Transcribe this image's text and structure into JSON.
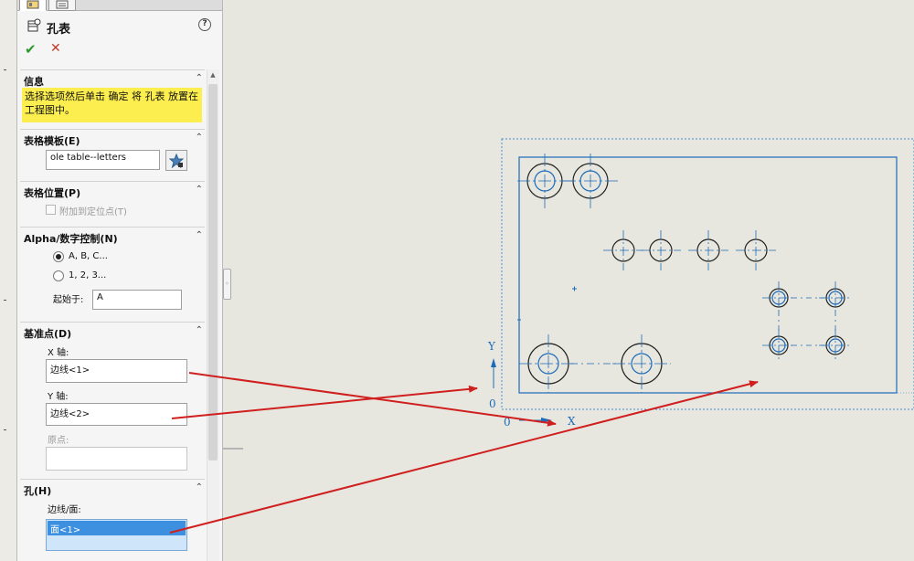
{
  "feature": {
    "title": "孔表"
  },
  "icons": {
    "ok": "✔",
    "cancel": "✕",
    "help": "?",
    "collapse": "⌃",
    "favorite": "favorite-star-icon"
  },
  "sections": {
    "info": {
      "title": "信息",
      "text": "选择选项然后单击 确定 将 孔表 放置在工程图中。"
    },
    "template": {
      "title": "表格模板(E)",
      "value": "ole table--letters"
    },
    "position": {
      "title": "表格位置(P)",
      "attach_label": "附加到定位点(T)",
      "attach_checked": false
    },
    "alpha": {
      "title": "Alpha/数字控制(N)",
      "option_alpha": "A, B, C...",
      "option_num": "1, 2, 3...",
      "selected": "A, B, C...",
      "start_label": "起始于:",
      "start_value": "A"
    },
    "datum": {
      "title": "基准点(D)",
      "x_label": "X 轴:",
      "x_value": "边线<1>",
      "y_label": "Y 轴:",
      "y_value": "边线<2>",
      "origin_label": "原点:",
      "origin_value": ""
    },
    "holes": {
      "title": "孔(H)",
      "label": "边线/面:",
      "items": [
        "面<1>"
      ]
    }
  },
  "drawing": {
    "y_axis_label": "Y",
    "x_axis_label": "X",
    "origin_y_label": "0",
    "origin_x_label": "0"
  },
  "colors": {
    "drawing_line": "#1e6bb8",
    "arrow": "#d01f1f",
    "highlight": "#fbee4e",
    "selection": "#3d8fe0"
  }
}
